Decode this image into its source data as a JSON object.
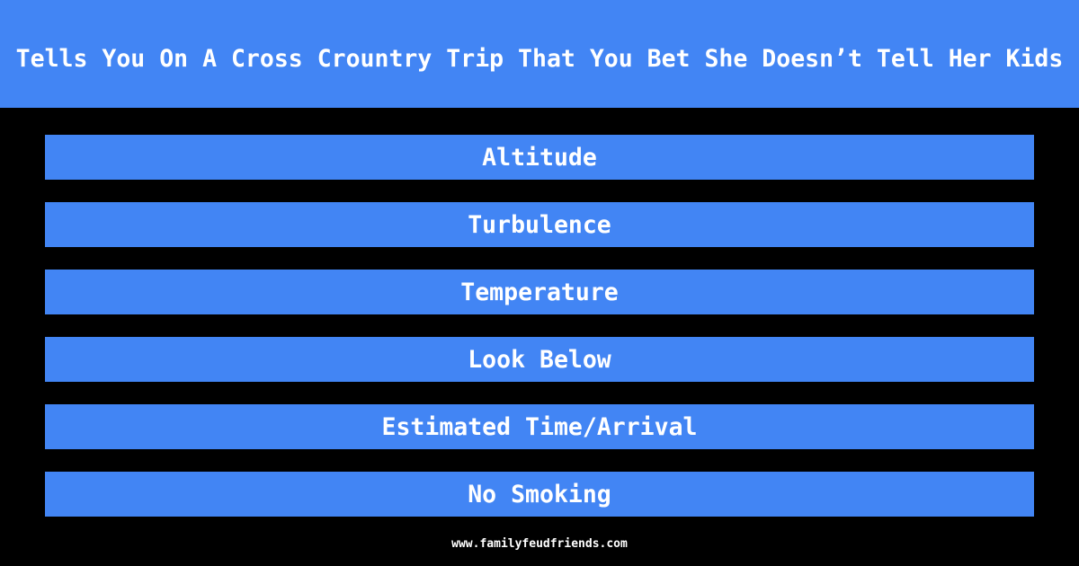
{
  "header": {
    "title": "Tells You On A Cross Crountry Trip That You Bet She Doesn’t Tell Her Kids"
  },
  "answers": [
    {
      "label": "Altitude"
    },
    {
      "label": "Turbulence"
    },
    {
      "label": "Temperature"
    },
    {
      "label": "Look Below"
    },
    {
      "label": "Estimated Time/Arrival"
    },
    {
      "label": "No Smoking"
    }
  ],
  "footer": {
    "url": "www.familyfeudfriends.com"
  },
  "colors": {
    "accent": "#4285F4",
    "background": "#000000",
    "text": "#ffffff"
  }
}
